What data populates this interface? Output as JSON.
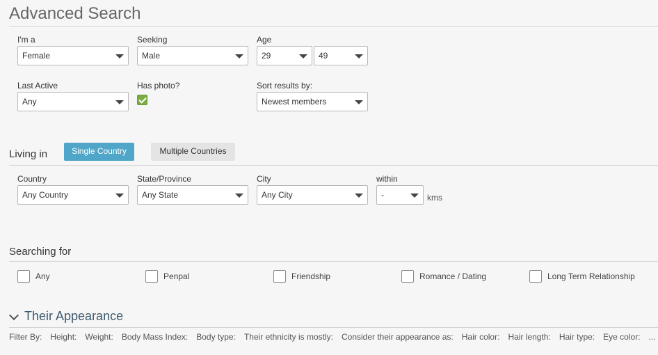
{
  "title": "Advanced Search",
  "basic": {
    "im_a": {
      "label": "I'm a",
      "value": "Female"
    },
    "seeking": {
      "label": "Seeking",
      "value": "Male"
    },
    "age": {
      "label": "Age",
      "min": "29",
      "max": "49"
    },
    "last_active": {
      "label": "Last Active",
      "value": "Any"
    },
    "has_photo": {
      "label": "Has photo?",
      "checked": true
    },
    "sort": {
      "label": "Sort results by:",
      "value": "Newest members"
    }
  },
  "living_in": {
    "label": "Living in",
    "single_country": "Single Country",
    "multiple_countries": "Multiple Countries",
    "country": {
      "label": "Country",
      "value": "Any Country"
    },
    "state": {
      "label": "State/Province",
      "value": "Any State"
    },
    "city": {
      "label": "City",
      "value": "Any City"
    },
    "within": {
      "label": "within",
      "value": "-"
    },
    "units": "kms"
  },
  "searching_for": {
    "label": "Searching for",
    "options": [
      "Any",
      "Penpal",
      "Friendship",
      "Romance / Dating",
      "Long Term Relationship"
    ]
  },
  "appearance": {
    "title": "Their Appearance",
    "filters": [
      "Filter By:",
      "Height:",
      "Weight:",
      "Body Mass Index:",
      "Body type:",
      "Their ethnicity is mostly:",
      "Consider their appearance as:",
      "Hair color:",
      "Hair length:",
      "Hair type:",
      "Eye color:",
      "..."
    ]
  },
  "colors": {
    "accent": "#4fa6c8",
    "checkbox": "#7cab43",
    "heading": "#3e5a6e"
  }
}
